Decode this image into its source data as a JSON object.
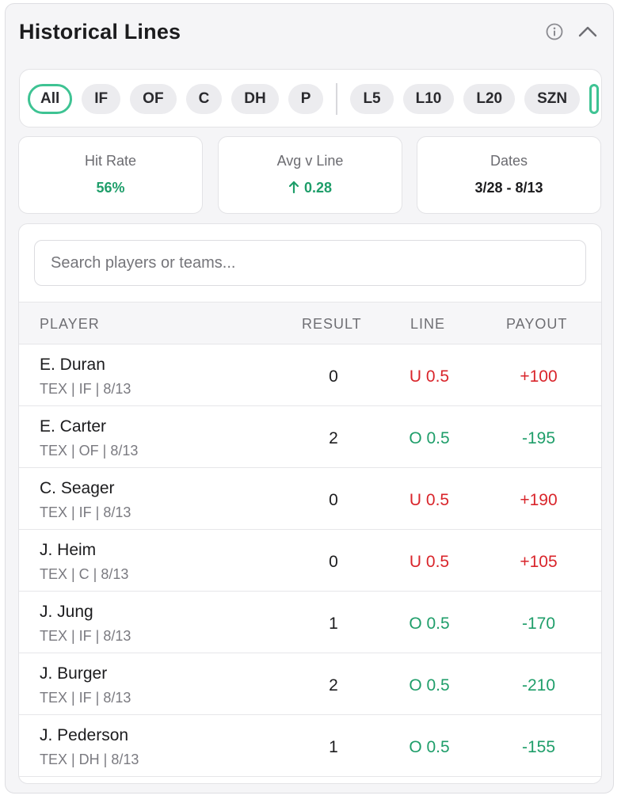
{
  "header": {
    "title": "Historical Lines",
    "info_icon": "info-icon",
    "collapse_icon": "chevron-up-icon"
  },
  "filters": {
    "positions": [
      "All",
      "IF",
      "OF",
      "C",
      "DH",
      "P"
    ],
    "ranges": [
      "L5",
      "L10",
      "L20",
      "SZN"
    ],
    "active": "All",
    "accent_color": "#3ec393"
  },
  "stats": {
    "hit_rate": {
      "label": "Hit Rate",
      "value": "56%"
    },
    "avg_v_line": {
      "label": "Avg v Line",
      "value": "0.28",
      "trend_icon": "arrow-up-icon"
    },
    "dates": {
      "label": "Dates",
      "value": "3/28 - 8/13"
    }
  },
  "search": {
    "placeholder": "Search players or teams...",
    "value": ""
  },
  "table": {
    "columns": {
      "player": "PLAYER",
      "result": "RESULT",
      "line": "LINE",
      "payout": "PAYOUT"
    },
    "colors": {
      "over": "#1f9e6a",
      "under": "#d9252b"
    },
    "rows": [
      {
        "name": "E. Duran",
        "meta": "TEX | IF | 8/13",
        "result": "0",
        "line": "U 0.5",
        "payout": "+100",
        "status": "under"
      },
      {
        "name": "E. Carter",
        "meta": "TEX | OF | 8/13",
        "result": "2",
        "line": "O 0.5",
        "payout": "-195",
        "status": "over"
      },
      {
        "name": "C. Seager",
        "meta": "TEX | IF | 8/13",
        "result": "0",
        "line": "U 0.5",
        "payout": "+190",
        "status": "under"
      },
      {
        "name": "J. Heim",
        "meta": "TEX | C | 8/13",
        "result": "0",
        "line": "U 0.5",
        "payout": "+105",
        "status": "under"
      },
      {
        "name": "J. Jung",
        "meta": "TEX | IF | 8/13",
        "result": "1",
        "line": "O 0.5",
        "payout": "-170",
        "status": "over"
      },
      {
        "name": "J. Burger",
        "meta": "TEX | IF | 8/13",
        "result": "2",
        "line": "O 0.5",
        "payout": "-210",
        "status": "over"
      },
      {
        "name": "J. Pederson",
        "meta": "TEX | DH | 8/13",
        "result": "1",
        "line": "O 0.5",
        "payout": "-155",
        "status": "over"
      }
    ]
  }
}
